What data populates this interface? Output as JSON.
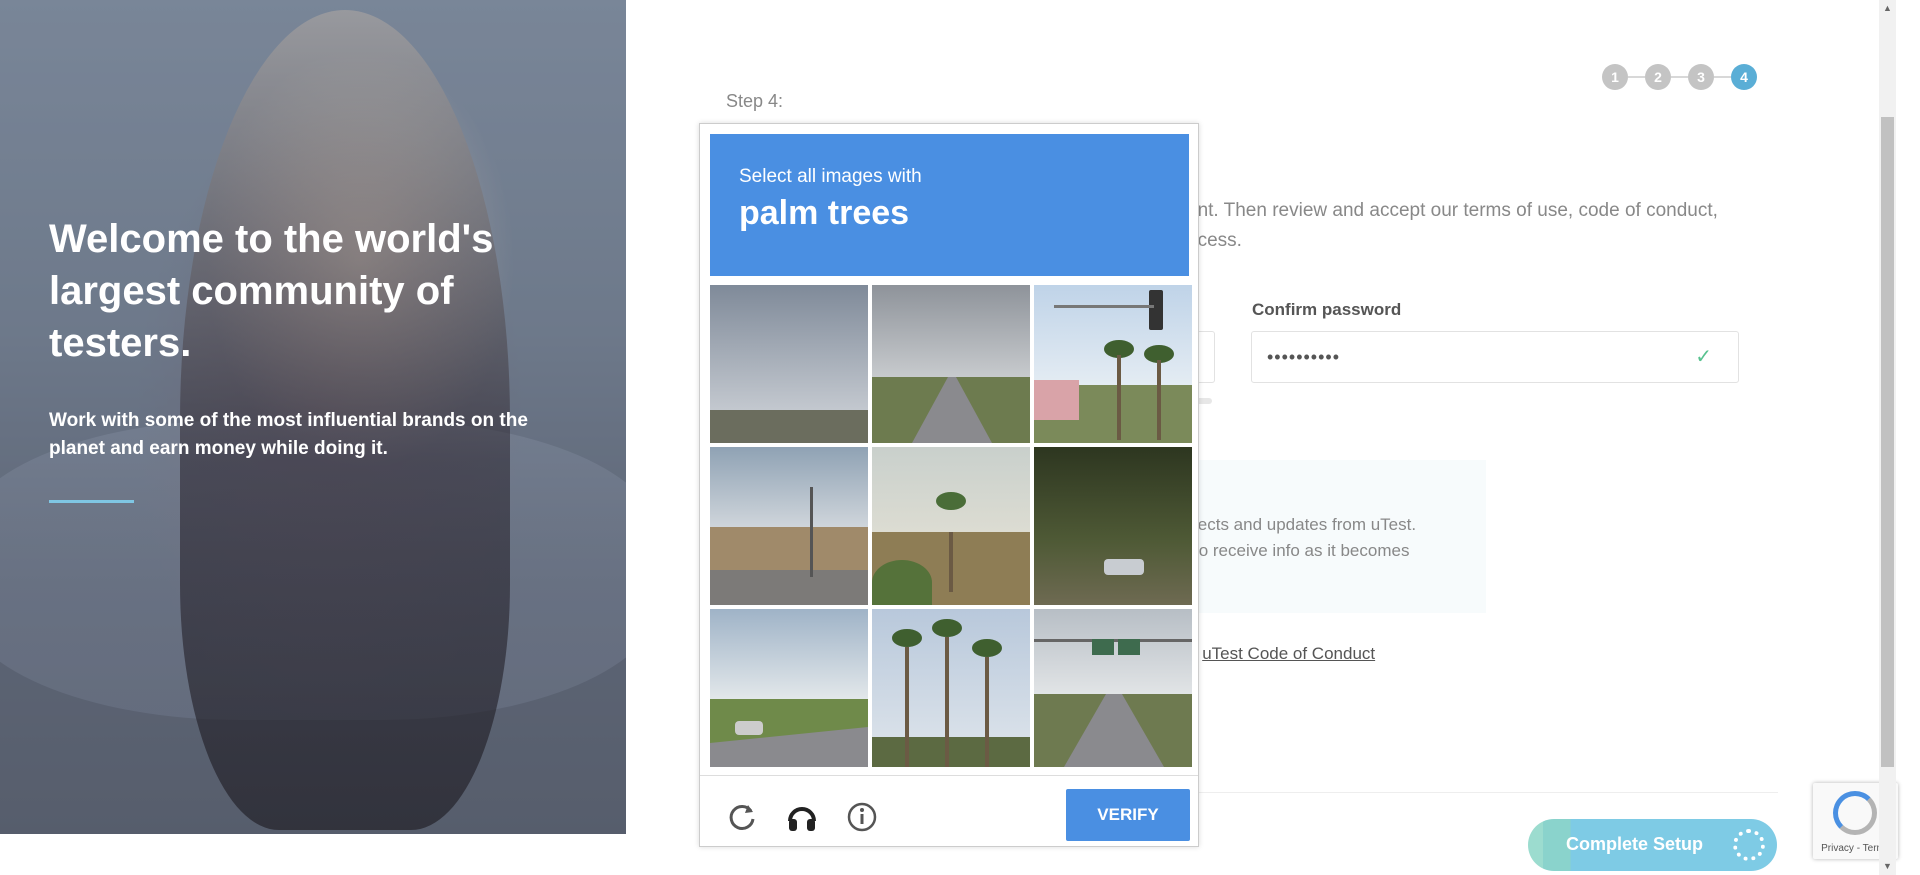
{
  "hero": {
    "title": "Welcome to the world's largest community of testers.",
    "subtitle": "Work with some of the most influential brands on the planet and earn money while doing it."
  },
  "form": {
    "step_label": "Step 4:",
    "steps": [
      "1",
      "2",
      "3",
      "4"
    ],
    "active_step": "4",
    "intro_line1": "unt. Then review and accept our terms of use, code of conduct,",
    "intro_line2": "ocess.",
    "confirm_password_label": "Confirm password",
    "confirm_password_value": "••••••••••",
    "notice_line1": "jects and updates from uTest.",
    "notice_line2": "to receive info as it becomes",
    "coc_prefix": "e ",
    "coc_link": "uTest Code of Conduct",
    "complete_button": "Complete Setup"
  },
  "captcha": {
    "instruction": "Select all images with",
    "target": "palm trees",
    "verify_button": "VERIFY",
    "tiles": [
      {
        "name": "captcha-tile-1"
      },
      {
        "name": "captcha-tile-2"
      },
      {
        "name": "captcha-tile-3"
      },
      {
        "name": "captcha-tile-4"
      },
      {
        "name": "captcha-tile-5"
      },
      {
        "name": "captcha-tile-6"
      },
      {
        "name": "captcha-tile-7"
      },
      {
        "name": "captcha-tile-8"
      },
      {
        "name": "captcha-tile-9"
      }
    ]
  },
  "recaptcha_badge": {
    "footer": "Privacy - Terms"
  },
  "colors": {
    "accent_blue": "#4a8fe2",
    "step_active": "#5aaed6",
    "success_green": "#58c28f"
  }
}
